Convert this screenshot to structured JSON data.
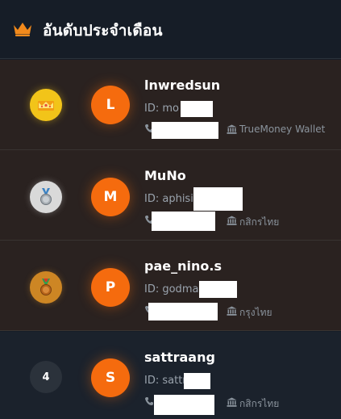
{
  "header": {
    "title": "อันดับประจำเดือน",
    "icon": "crown-icon",
    "accent_color": "#f28a1c"
  },
  "leaderboard": [
    {
      "rank_badge": "gold-crown-icon",
      "rank_text": "",
      "avatar_letter": "L",
      "username": "lnwredsun",
      "id_text": "ID: mo",
      "bank": "TrueMoney Wallet"
    },
    {
      "rank_badge": "silver-medal-icon",
      "rank_text": "",
      "avatar_letter": "M",
      "username": "MuNo",
      "id_text": "ID: aphisit",
      "bank": "กสิกรไทย"
    },
    {
      "rank_badge": "bronze-medal-icon",
      "rank_text": "",
      "avatar_letter": "P",
      "username": "pae_nino.s",
      "id_text": "ID: godma",
      "bank": "กรุงไทย"
    },
    {
      "rank_badge": "",
      "rank_text": "4",
      "avatar_letter": "S",
      "username": "sattraang",
      "id_text": "ID: sattr",
      "bank": "กสิกรไทย"
    }
  ],
  "colors": {
    "avatar": "#f56b0e",
    "gold": "#f2c419",
    "silver": "#d9d9d9",
    "bronze": "#cd8624"
  }
}
